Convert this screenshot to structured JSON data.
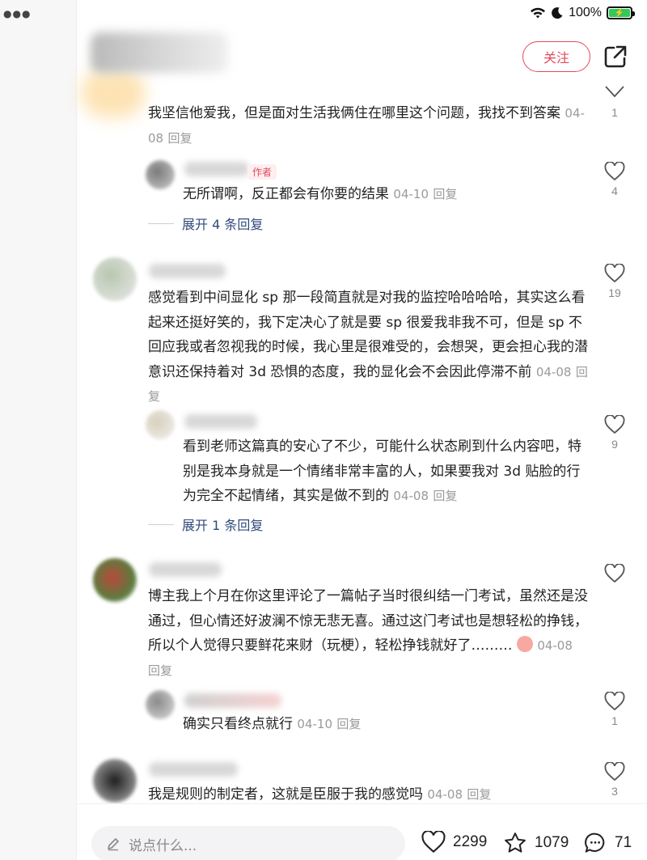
{
  "status_bar": {
    "battery": "100%"
  },
  "header": {
    "follow_label": "关注"
  },
  "comments": [
    {
      "text": "我坚信他爱我，但是面对生活我俩住在哪里这个问题，我找不到答案",
      "date": "04-08",
      "reply": "回复",
      "likes": "1",
      "replies": [
        {
          "author_tag": "作者",
          "text": "无所谓啊，反正都会有你要的结果",
          "date": "04-10",
          "reply": "回复",
          "likes": "4"
        }
      ],
      "expand": "展开 4 条回复"
    },
    {
      "text": "感觉看到中间显化 sp 那一段简直就是对我的监控哈哈哈哈，其实这么看起来还挺好笑的，我下定决心了就是要 sp 很爱我非我不可，但是 sp 不回应我或者忽视我的时候，我心里是很难受的，会想哭，更会担心我的潜意识还保持着对 3d 恐惧的态度，我的显化会不会因此停滞不前",
      "date": "04-08",
      "reply": "回复",
      "likes": "19",
      "replies": [
        {
          "text": "看到老师这篇真的安心了不少，可能什么状态刷到什么内容吧，特别是我本身就是一个情绪非常丰富的人，如果要我对 3d 贴脸的行为完全不起情绪，其实是做不到的",
          "date": "04-08",
          "reply": "回复",
          "likes": "9"
        }
      ],
      "expand": "展开 1 条回复"
    },
    {
      "text": "博主我上个月在你这里评论了一篇帖子当时很纠结一门考试，虽然还是没通过，但心情还好波澜不惊无悲无喜。通过这门考试也是想轻松的挣钱，所以个人觉得只要鲜花来财（玩梗），轻松挣钱就好了………",
      "date": "04-08",
      "reply": "回复",
      "likes": "",
      "replies": [
        {
          "text": "确实只看终点就行",
          "date": "04-10",
          "reply": "回复",
          "likes": "1"
        }
      ]
    },
    {
      "text": "我是规则的制定者，这就是臣服于我的感觉吗",
      "date": "04-08",
      "reply": "回复",
      "likes": "3"
    }
  ],
  "bottom_bar": {
    "input_placeholder": "说点什么...",
    "likes": "2299",
    "favorites": "1079",
    "comments": "71"
  }
}
